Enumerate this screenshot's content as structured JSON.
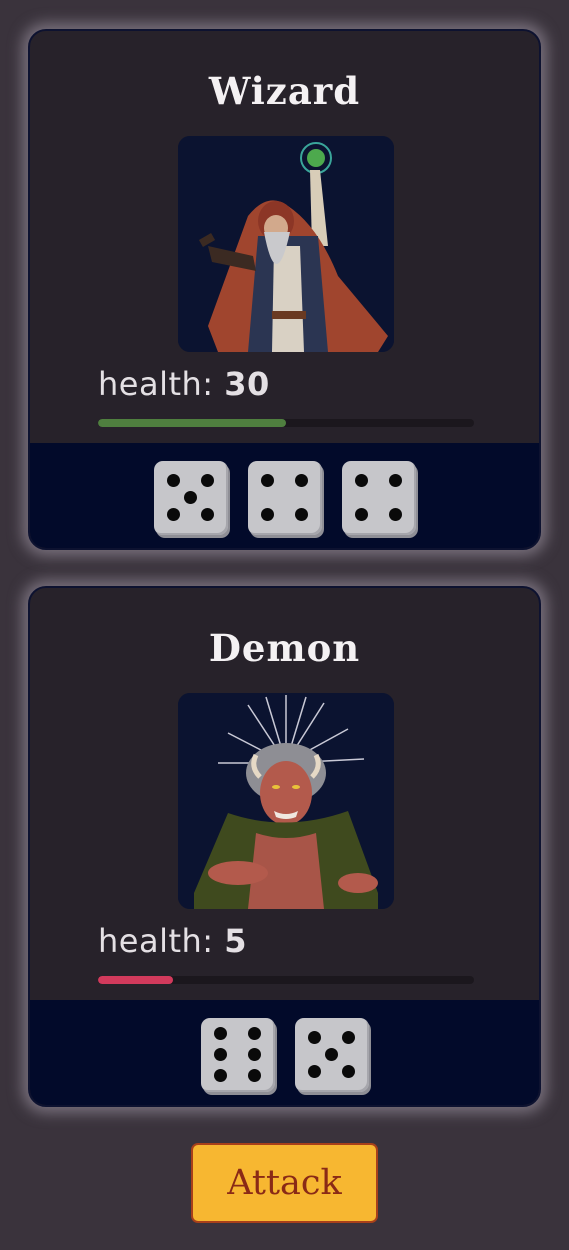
{
  "characters": [
    {
      "name": "Wizard",
      "health_label": "health:",
      "health": "30",
      "health_fraction": 0.5,
      "bar_color": "#4f7f3f",
      "dice": [
        5,
        4,
        4
      ]
    },
    {
      "name": "Demon",
      "health_label": "health:",
      "health": "5",
      "health_fraction": 0.2,
      "bar_color": "#d23a5c",
      "dice": [
        6,
        5
      ]
    }
  ],
  "attack_button": {
    "label": "Attack"
  },
  "colors": {
    "background": "#3a333c",
    "card": "#27222a",
    "dice_strip": "#020a2a",
    "button": "#f7b731"
  }
}
